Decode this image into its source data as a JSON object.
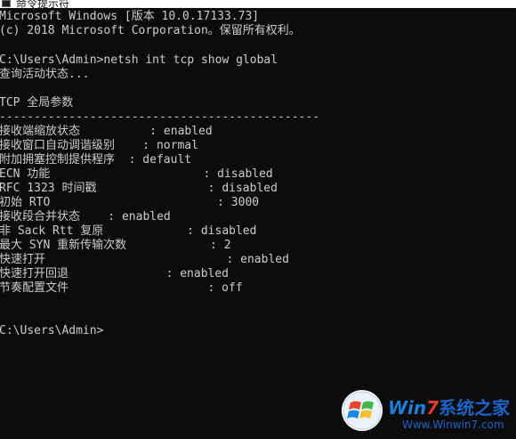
{
  "window": {
    "title": "命令提示符"
  },
  "console": {
    "lines": [
      "Microsoft Windows [版本 10.0.17133.73]",
      "(c) 2018 Microsoft Corporation。保留所有权利。",
      "",
      "C:\\Users\\Admin>netsh int tcp show global",
      "查询活动状态...",
      "",
      "TCP 全局参数",
      "----------------------------------------------",
      "接收端缩放状态          : enabled",
      "接收窗口自动调谐级别    : normal",
      "附加拥塞控制提供程序  : default",
      "ECN 功能                      : disabled",
      "RFC 1323 时间戳                : disabled",
      "初始 RTO                        : 3000",
      "接收段合并状态    : enabled",
      "非 Sack Rtt 复原            : disabled",
      "最大 SYN 重新传输次数            : 2",
      "快速打开                          : enabled",
      "快速打开回退              : enabled",
      "节奏配置文件                    : off",
      "",
      "",
      "C:\\Users\\Admin>"
    ]
  },
  "watermark": {
    "brand_prefix": "Win",
    "brand_seven": "7",
    "brand_rest": "系统之家",
    "url": "Www.Winwin7.com",
    "colors": {
      "blue": "#1b63c8",
      "red": "#e53935"
    }
  }
}
